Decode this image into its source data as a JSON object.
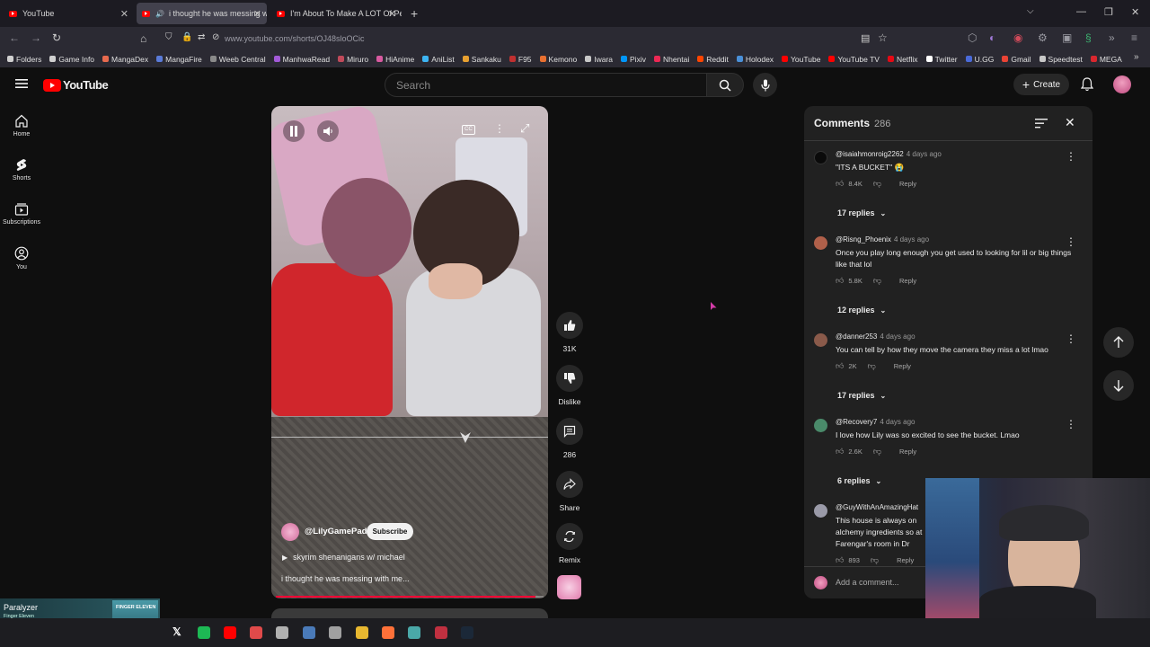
{
  "tabs": [
    {
      "title": "YouTube"
    },
    {
      "title": "i thought he was messing w"
    },
    {
      "title": "I'm About To Make A LOT Of Pe"
    }
  ],
  "url": "www.youtube.com/shorts/OJ48sloOCic",
  "bookmarks": [
    {
      "label": "Folders",
      "color": "#d0d0d0"
    },
    {
      "label": "Game Info",
      "color": "#d0d0d0"
    },
    {
      "label": "MangaDex",
      "color": "#e86a4e"
    },
    {
      "label": "MangaFire",
      "color": "#5a7bd8"
    },
    {
      "label": "Weeb Central",
      "color": "#8a8a8a"
    },
    {
      "label": "ManhwaRead",
      "color": "#a25ad8"
    },
    {
      "label": "Miruro",
      "color": "#c04a5a"
    },
    {
      "label": "HiAnime",
      "color": "#d85aa0"
    },
    {
      "label": "AniList",
      "color": "#3db4f2"
    },
    {
      "label": "Sankaku",
      "color": "#e8a030"
    },
    {
      "label": "F95",
      "color": "#c03030"
    },
    {
      "label": "Kemono",
      "color": "#e87030"
    },
    {
      "label": "Iwara",
      "color": "#c8c8c8"
    },
    {
      "label": "Pixiv",
      "color": "#0096fa"
    },
    {
      "label": "Nhentai",
      "color": "#ec2854"
    },
    {
      "label": "Reddit",
      "color": "#ff4500"
    },
    {
      "label": "Holodex",
      "color": "#4a90d8"
    },
    {
      "label": "YouTube",
      "color": "#ff0000"
    },
    {
      "label": "YouTube TV",
      "color": "#ff0000"
    },
    {
      "label": "Netflix",
      "color": "#e50914"
    },
    {
      "label": "Twitter",
      "color": "#ffffff"
    },
    {
      "label": "U.GG",
      "color": "#4a6ad8"
    },
    {
      "label": "Gmail",
      "color": "#ea4335"
    },
    {
      "label": "Speedtest",
      "color": "#c8c8c8"
    },
    {
      "label": "MEGA",
      "color": "#d9272e"
    }
  ],
  "header": {
    "logo_text": "YouTube",
    "search_placeholder": "Search",
    "create_label": "Create"
  },
  "sidebar": [
    {
      "label": "Home"
    },
    {
      "label": "Shorts"
    },
    {
      "label": "Subscriptions"
    },
    {
      "label": "You"
    }
  ],
  "short": {
    "channel": "@LilyGamePad",
    "subscribe_label": "Subscribe",
    "playlist": "skyrim shenanigans w/ michael",
    "title": "i thought he was messing with me...",
    "likes": "31K",
    "dislike_label": "Dislike",
    "comments_count": "286",
    "share_label": "Share",
    "remix_label": "Remix",
    "progress": 0.97
  },
  "comments_panel": {
    "title": "Comments",
    "count": "286",
    "add_placeholder": "Add a comment...",
    "reply_label": "Reply",
    "items": [
      {
        "author": "@isaiahmonroig2262",
        "time": "4 days ago",
        "text": "\"ITS A BUCKET\" 😭",
        "likes": "8.4K",
        "replies": "17 replies",
        "avatar_color": "#111111"
      },
      {
        "author": "@Risng_Phoenix",
        "time": "4 days ago",
        "text": "Once you play long enough you get used to looking for lil or big things like that lol",
        "likes": "5.8K",
        "replies": "12 replies",
        "avatar_color": "#b0604a"
      },
      {
        "author": "@danner253",
        "time": "4 days ago",
        "text": "You can tell by how they move the camera they miss a lot lmao",
        "likes": "2K",
        "replies": "17 replies",
        "avatar_color": "#8a5a4a"
      },
      {
        "author": "@Recovery7",
        "time": "4 days ago",
        "text": "I love how Lily was so excited to see the bucket. Lmao",
        "likes": "2.6K",
        "replies": "6 replies",
        "avatar_color": "#4a8a6a"
      },
      {
        "author": "@GuyWithAnAmazingHat",
        "time": "",
        "text": "This house is always on alchemy ingredients so at Farengar's room in Dr",
        "likes": "893",
        "replies": "",
        "avatar_color": "#9a9aa8"
      }
    ]
  },
  "spotify": {
    "song": "Paralyzer",
    "artist": "Finger Eleven",
    "art_text": "FINGER ELEVEN"
  },
  "colors": {
    "brand_red": "#ff0000",
    "background": "#0f0f0f",
    "panel": "#212121"
  }
}
